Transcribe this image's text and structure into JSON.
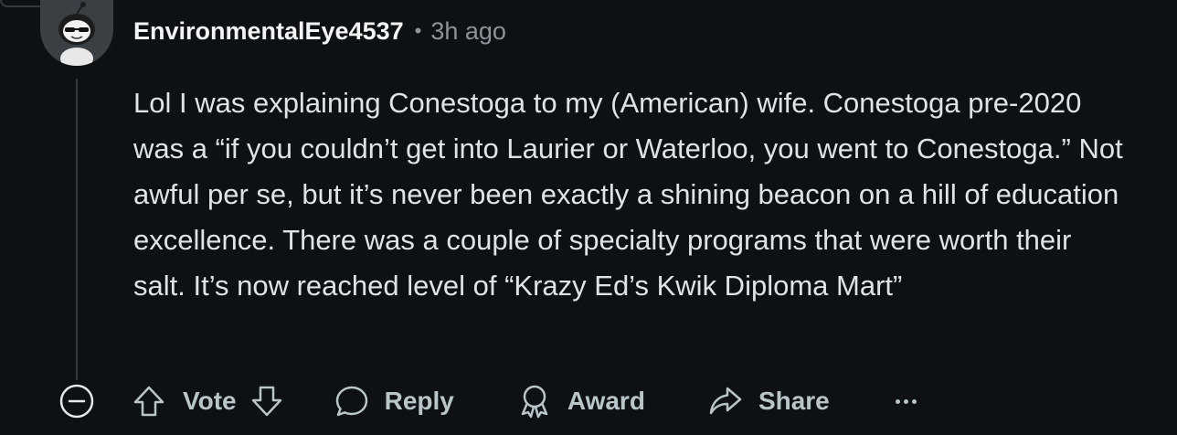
{
  "comment": {
    "username": "EnvironmentalEye4537",
    "separator": "•",
    "timestamp": "3h ago",
    "body": "Lol I was explaining Conestoga to my (American) wife. Conestoga pre-2020 was a “if you couldn’t get into Laurier or Waterloo, you went to Conestoga.” Not awful per se, but it’s never been exactly a shining beacon on a hill of education excellence. There was a couple of specialty programs that were worth their salt. It’s now reached level of “Krazy Ed’s Kwik Diploma Mart”"
  },
  "actions": {
    "collapse_icon": "minus-circle-icon",
    "upvote_icon": "arrow-up-icon",
    "vote_label": "Vote",
    "downvote_icon": "arrow-down-icon",
    "reply_label": "Reply",
    "reply_icon": "comment-bubble-icon",
    "award_label": "Award",
    "award_icon": "award-ribbon-icon",
    "share_label": "Share",
    "share_icon": "share-arrow-icon",
    "more_icon": "more-dots-icon"
  },
  "colors": {
    "background": "#0e1113",
    "text": "#dfe3e6",
    "muted": "#8c9499",
    "action": "#b8c5c9"
  }
}
